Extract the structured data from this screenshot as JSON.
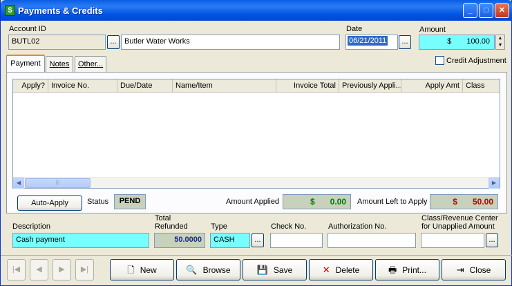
{
  "window": {
    "title": "Payments & Credits",
    "icon": "dollar-app-icon"
  },
  "account": {
    "id_label": "Account ID",
    "id_value": "BUTL02",
    "name_value": "Butler Water Works"
  },
  "date": {
    "label": "Date",
    "value": "06/21/2011"
  },
  "amount": {
    "label": "Amount",
    "currency": "$",
    "value": "100.00"
  },
  "credit_adjustment": {
    "label": "Credit Adjustment",
    "checked": false
  },
  "tabs": [
    {
      "label": "Payment"
    },
    {
      "label": "Notes"
    },
    {
      "label": "Other..."
    }
  ],
  "grid": {
    "columns": [
      "Apply?",
      "Invoice No.",
      "Due/Date",
      "Name/Item",
      "Invoice Total",
      "Previously Appli...",
      "Apply Amt",
      "Class"
    ],
    "rows": []
  },
  "auto_apply": {
    "label": "Auto-Apply"
  },
  "status": {
    "label": "Status",
    "value": "PEND"
  },
  "amount_applied": {
    "label": "Amount Applied",
    "currency": "$",
    "value": "0.00",
    "color": "#008000"
  },
  "amount_left": {
    "label": "Amount Left to Apply",
    "currency": "$",
    "value": "50.00",
    "color": "#c00000"
  },
  "description": {
    "label": "Description",
    "value": "Cash payment"
  },
  "total_refunded": {
    "label_line1": "Total",
    "label_line2": "Refunded",
    "value": "50.0000"
  },
  "type": {
    "label": "Type",
    "value": "CASH"
  },
  "check_no": {
    "label": "Check No.",
    "value": ""
  },
  "authorization_no": {
    "label": "Authorization No.",
    "value": ""
  },
  "class_revenue": {
    "label_line1": "Class/Revenue Center",
    "label_line2": "for Unapplied Amount",
    "value": ""
  },
  "toolbar": {
    "new": "New",
    "browse": "Browse",
    "save": "Save",
    "delete": "Delete",
    "print": "Print...",
    "close": "Close"
  }
}
